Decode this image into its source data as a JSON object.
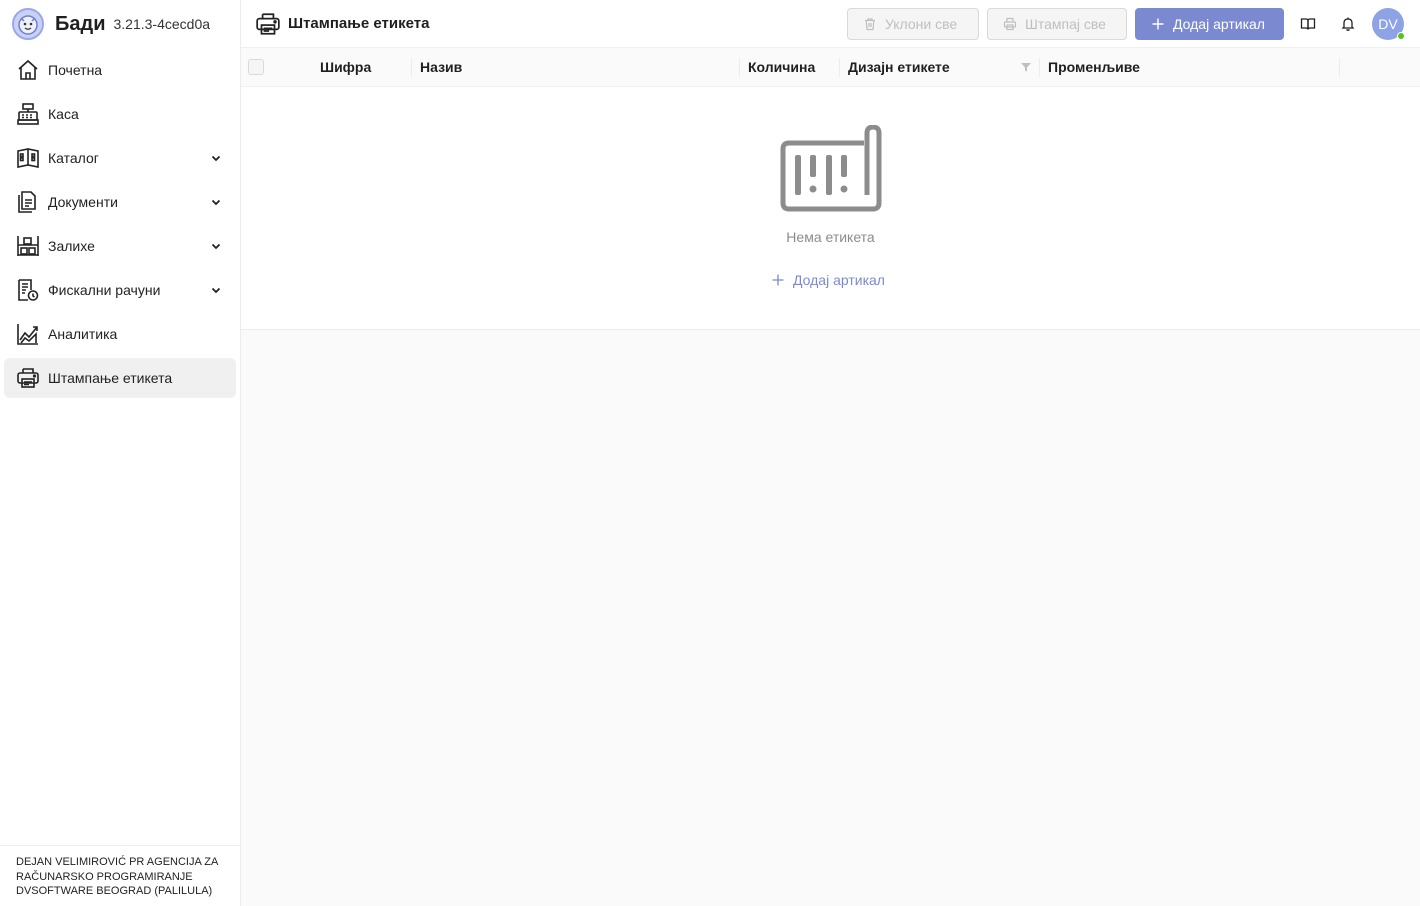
{
  "brand": {
    "name": "Бади",
    "version": "3.21.3-4cecd0a"
  },
  "sidebar": {
    "items": [
      {
        "label": "Почетна",
        "icon": "home-icon",
        "expandable": false
      },
      {
        "label": "Каса",
        "icon": "cash-register-icon",
        "expandable": false
      },
      {
        "label": "Каталог",
        "icon": "catalog-icon",
        "expandable": true
      },
      {
        "label": "Документи",
        "icon": "documents-icon",
        "expandable": true
      },
      {
        "label": "Залихе",
        "icon": "stock-icon",
        "expandable": true
      },
      {
        "label": "Фискални рачуни",
        "icon": "fiscal-receipt-icon",
        "expandable": true
      },
      {
        "label": "Аналитика",
        "icon": "analytics-icon",
        "expandable": false
      },
      {
        "label": "Штампање етикета",
        "icon": "label-printer-icon",
        "expandable": false,
        "active": true
      }
    ],
    "footer": "DEJAN VELIMIROVIĆ PR AGENCIJA ZA RAČUNARSKO PROGRAMIRANJE DVSOFTWARE BEOGRAD (PALILULA)"
  },
  "header": {
    "title": "Штампање етикета",
    "icon": "label-printer-icon",
    "remove_all_label": "Уклони све",
    "print_all_label": "Штампај све",
    "add_item_label": "Додај артикал",
    "avatar_initials": "DV"
  },
  "table": {
    "columns": {
      "code": "Шифра",
      "name": "Назив",
      "quantity": "Количина",
      "design": "Дизајн етикете",
      "variables": "Променљиве"
    },
    "empty_text": "Нема етикета",
    "empty_add_label": "Додај артикал"
  },
  "colors": {
    "primary": "#7b8ad0",
    "avatar": "#8ea3e5",
    "online": "#52c41a"
  }
}
